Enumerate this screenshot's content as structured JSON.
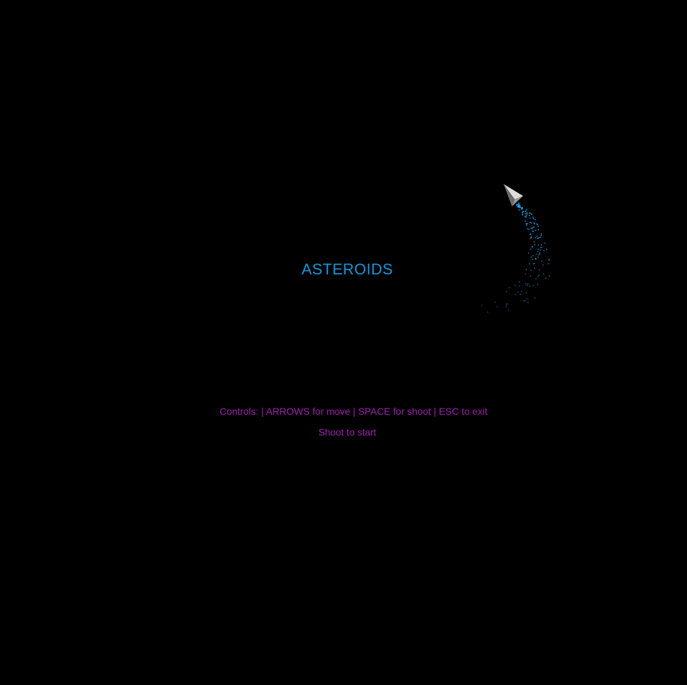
{
  "game": {
    "title": "ASTEROIDS",
    "controls_text": "Controls: | ARROWS for move | SPACE for shoot | ESC to exit",
    "start_text": "Shoot to start"
  },
  "colors": {
    "background": "#000000",
    "title": "#1a95d8",
    "text": "#a020b0",
    "particles": "#1ea0e6",
    "ship_light": "#d8d8d8",
    "ship_dark": "#555555"
  },
  "icons": {
    "ship": "spaceship-icon"
  }
}
